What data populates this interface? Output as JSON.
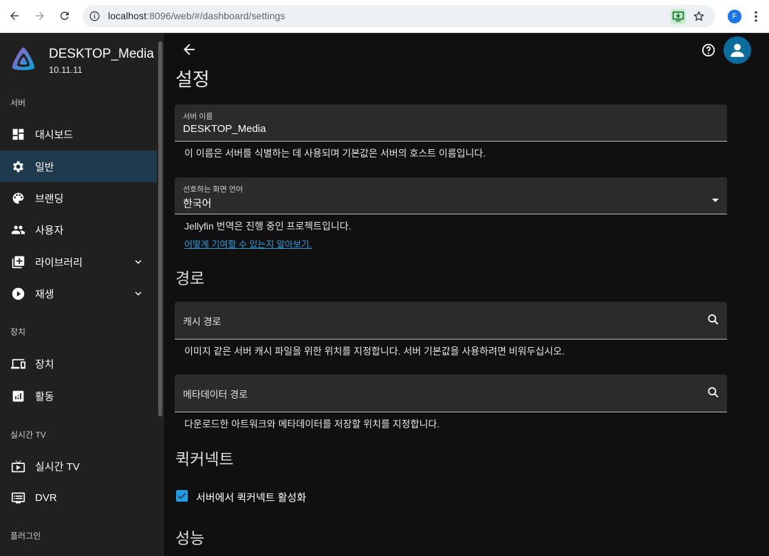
{
  "browser": {
    "url_host": "localhost",
    "url_rest": ":8096/web/#/dashboard/settings",
    "profile_initial": "F"
  },
  "sidebar": {
    "server_name": "DESKTOP_Media",
    "server_version": "10.11.11",
    "sections": {
      "server": "서버",
      "devices": "장치",
      "livetv": "실시간 TV",
      "plugins": "플러그인"
    },
    "items": {
      "dashboard": "대시보드",
      "general": "일반",
      "branding": "브랜딩",
      "users": "사용자",
      "libraries": "라이브러리",
      "playback": "재생",
      "devices": "장치",
      "activity": "활동",
      "livetv": "실시간 TV",
      "dvr": "DVR"
    }
  },
  "main": {
    "page_title": "설정",
    "server_name_field": {
      "label": "서버 이름",
      "value": "DESKTOP_Media",
      "help": "이 이름은 서버를 식별하는 데 사용되며 기본값은 서버의 호스트 이름입니다."
    },
    "language_field": {
      "label": "선호하는 화면 언어",
      "value": "한국어",
      "help": "Jellyfin 번역은 진행 중인 프로젝트입니다.",
      "link": "어떻게 기여할 수 있는지 알아보기."
    },
    "paths_title": "경로",
    "cache_path": {
      "placeholder": "캐시 경로",
      "help": "이미지 같은 서버 캐시 파일을 위한 위치를 지정합니다. 서버 기본값을 사용하려면 비워두십시오."
    },
    "metadata_path": {
      "placeholder": "메타데이터 경로",
      "help": "다운로드한 아트워크와 메타데이터를 저장할 위치를 지정합니다."
    },
    "quickconnect_title": "퀵커넥트",
    "quickconnect_checkbox": "서버에서 퀵커넥트 활성화",
    "quickconnect_checked": true,
    "performance_title": "성능"
  },
  "colors": {
    "accent": "#1d9be3",
    "active_nav": "#203a4d",
    "link": "#27a0e0"
  }
}
